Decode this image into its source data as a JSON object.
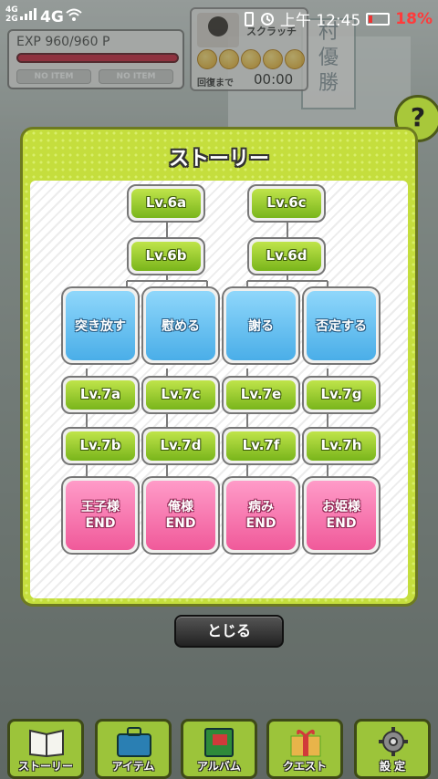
{
  "status_bar": {
    "signal_top": "4G",
    "signal_bottom": "2G",
    "network": "4G",
    "time": "上午 12:45",
    "battery": "18%",
    "battery_color": "#ff3b3b"
  },
  "hud": {
    "exp_text": "EXP 960/960 P",
    "exp_fraction": 1.0,
    "item_slot_1": "NO ITEM",
    "item_slot_2": "NO ITEM",
    "scratch_label": "スクラッチ",
    "coin_count": 5,
    "recover_label": "回復まで",
    "recover_time": "00:00",
    "help_label": "?"
  },
  "story_panel": {
    "title": "ストーリー",
    "top_row": [
      "Lv.6a",
      "Lv.6c"
    ],
    "second_row": [
      "Lv.6b",
      "Lv.6d"
    ],
    "choices": [
      "突き放す",
      "慰める",
      "謝る",
      "否定する"
    ],
    "lv7_row_1": [
      "Lv.7a",
      "Lv.7c",
      "Lv.7e",
      "Lv.7g"
    ],
    "lv7_row_2": [
      "Lv.7b",
      "Lv.7d",
      "Lv.7f",
      "Lv.7h"
    ],
    "endings": [
      {
        "name": "王子様",
        "suffix": "END"
      },
      {
        "name": "俺様",
        "suffix": "END"
      },
      {
        "name": "病み",
        "suffix": "END"
      },
      {
        "name": "お姫様",
        "suffix": "END"
      }
    ],
    "close_label": "とじる"
  },
  "background_sign": [
    "村",
    "優",
    "勝"
  ],
  "bottom_nav": [
    {
      "label": "ストーリー",
      "icon": "book-icon"
    },
    {
      "label": "アイテム",
      "icon": "bag-icon"
    },
    {
      "label": "アルバム",
      "icon": "album-icon"
    },
    {
      "label": "クエスト",
      "icon": "gift-icon"
    },
    {
      "label": "設 定",
      "icon": "gear-icon"
    }
  ],
  "colors": {
    "panel_green": "#c5de3d",
    "level_green": "#79b51b",
    "choice_blue": "#4aaee8",
    "ending_pink": "#f05a9a",
    "exp_red": "#c81c36"
  }
}
